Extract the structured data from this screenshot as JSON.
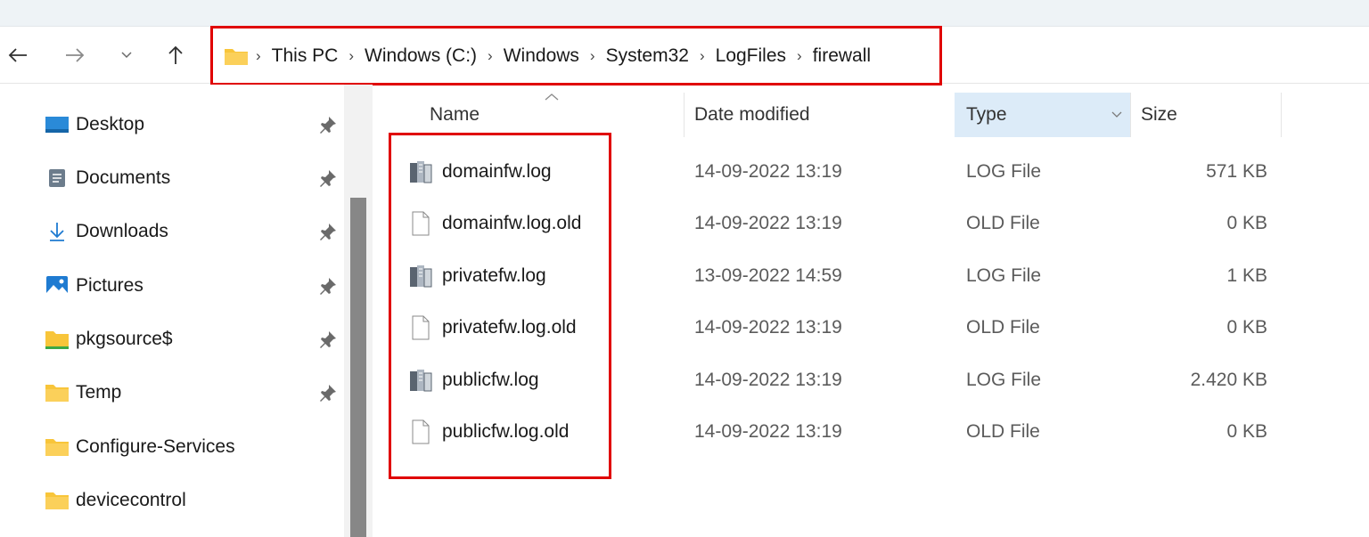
{
  "navigation": {
    "back_icon": "arrow-left-icon",
    "forward_icon": "arrow-right-icon",
    "recent_icon": "chevron-down-icon",
    "up_icon": "arrow-up-icon"
  },
  "breadcrumb": {
    "segments": [
      "This PC",
      "Windows (C:)",
      "Windows",
      "System32",
      "LogFiles",
      "firewall"
    ]
  },
  "sidebar": {
    "items": [
      {
        "label": "Desktop",
        "icon": "desktop-icon",
        "pinned": true
      },
      {
        "label": "Documents",
        "icon": "documents-icon",
        "pinned": true
      },
      {
        "label": "Downloads",
        "icon": "download-arrow-icon",
        "pinned": true
      },
      {
        "label": "Pictures",
        "icon": "pictures-icon",
        "pinned": true
      },
      {
        "label": "pkgsource$",
        "icon": "network-folder-icon",
        "pinned": true
      },
      {
        "label": "Temp",
        "icon": "folder-icon",
        "pinned": true
      },
      {
        "label": "Configure-Services",
        "icon": "folder-icon",
        "pinned": false
      },
      {
        "label": "devicecontrol",
        "icon": "folder-icon",
        "pinned": false
      }
    ]
  },
  "columns": {
    "name": "Name",
    "date": "Date modified",
    "type": "Type",
    "size": "Size"
  },
  "files": [
    {
      "name": "domainfw.log",
      "date": "14-09-2022 13:19",
      "type": "LOG File",
      "size": "571 KB",
      "icon": "log-file-icon"
    },
    {
      "name": "domainfw.log.old",
      "date": "14-09-2022 13:19",
      "type": "OLD File",
      "size": "0 KB",
      "icon": "blank-file-icon"
    },
    {
      "name": "privatefw.log",
      "date": "13-09-2022 14:59",
      "type": "LOG File",
      "size": "1 KB",
      "icon": "log-file-icon"
    },
    {
      "name": "privatefw.log.old",
      "date": "14-09-2022 13:19",
      "type": "OLD File",
      "size": "0 KB",
      "icon": "blank-file-icon"
    },
    {
      "name": "publicfw.log",
      "date": "14-09-2022 13:19",
      "type": "LOG File",
      "size": "2.420 KB",
      "icon": "log-file-icon"
    },
    {
      "name": "publicfw.log.old",
      "date": "14-09-2022 13:19",
      "type": "OLD File",
      "size": "0 KB",
      "icon": "blank-file-icon"
    }
  ],
  "colors": {
    "highlight_border": "#e00000",
    "selected_column": "#dcebf8",
    "folder_yellow": "#f8c53a"
  }
}
